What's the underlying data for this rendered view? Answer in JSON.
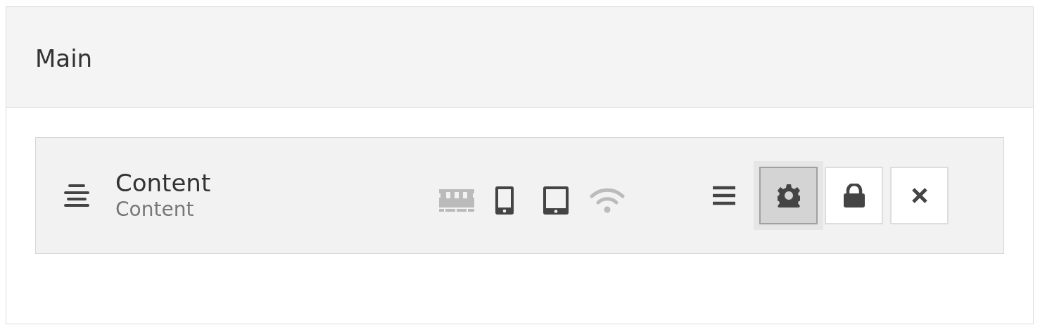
{
  "panel": {
    "title": "Main"
  },
  "block": {
    "title": "Content",
    "subtitle": "Content",
    "devices": [
      {
        "kind": "desktop",
        "on": false
      },
      {
        "kind": "phone",
        "on": true
      },
      {
        "kind": "tablet",
        "on": true
      },
      {
        "kind": "wifi",
        "on": false
      }
    ],
    "actions": [
      {
        "kind": "settings",
        "selected": true
      },
      {
        "kind": "lock",
        "selected": false
      },
      {
        "kind": "close",
        "selected": false
      }
    ]
  }
}
